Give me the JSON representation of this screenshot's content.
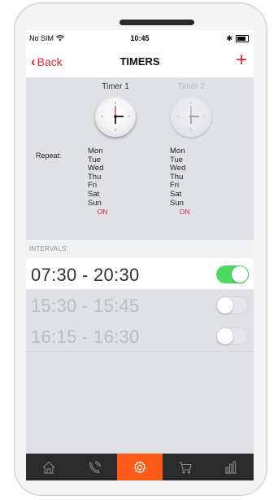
{
  "status_bar": {
    "carrier": "No SIM",
    "time": "10:45"
  },
  "nav": {
    "back_label": "Back",
    "title": "TIMERS",
    "add_label": "+"
  },
  "timers": [
    {
      "name": "Timer 1",
      "status": "ON",
      "active": true
    },
    {
      "name": "Timer 2",
      "status": "ON",
      "active": false
    }
  ],
  "repeat_label": "Repeat:",
  "days": [
    "Mon",
    "Tue",
    "Wed",
    "Thu",
    "Fri",
    "Sat",
    "Sun"
  ],
  "intervals_header": "INTERVALS:",
  "intervals": [
    {
      "time": "07:30 - 20:30",
      "enabled": true
    },
    {
      "time": "15:30 - 15:45",
      "enabled": false
    },
    {
      "time": "16:15 - 16:30",
      "enabled": false
    }
  ],
  "tabs": [
    {
      "icon": "home-icon",
      "selected": false
    },
    {
      "icon": "phone-icon",
      "selected": false
    },
    {
      "icon": "gear-icon",
      "selected": true
    },
    {
      "icon": "cart-icon",
      "selected": false
    },
    {
      "icon": "chart-icon",
      "selected": false
    }
  ],
  "colors": {
    "accent": "#e0262b",
    "tab_selected": "#ff5a1a",
    "toggle_on": "#4cd964"
  }
}
